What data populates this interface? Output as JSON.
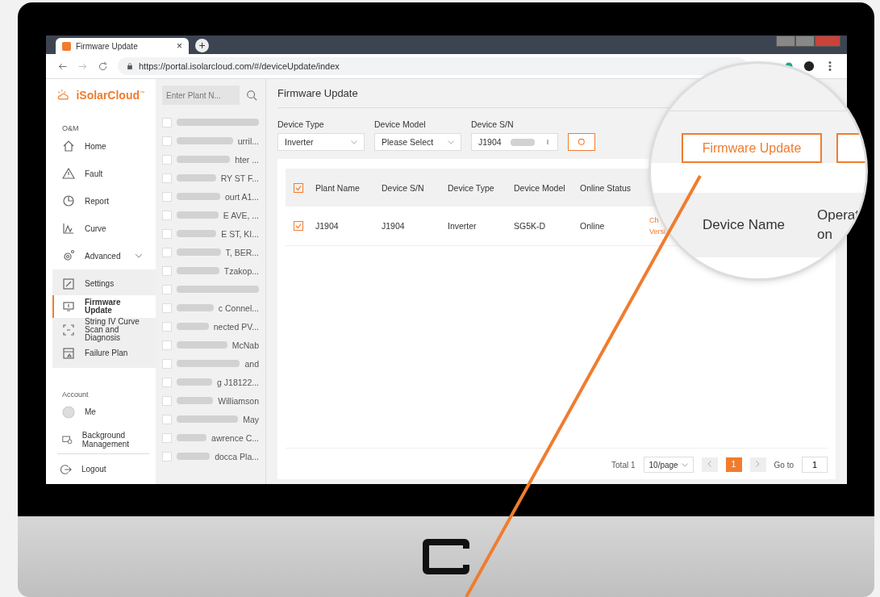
{
  "browser": {
    "tab_title": "Firmware Update",
    "tab_close": "×",
    "new_tab": "+",
    "url": "https://portal.isolarcloud.com/#/deviceUpdate/index"
  },
  "sidebar": {
    "logo": "iSolarCloud$^{™}$",
    "sections": [
      {
        "title": "O&M",
        "items": [
          {
            "kind": "link",
            "label": "Home",
            "selected": false
          },
          {
            "kind": "link",
            "label": "Fault",
            "selected": false
          },
          {
            "kind": "link",
            "label": "Report",
            "selected": false
          },
          {
            "kind": "link",
            "label": "Curve",
            "selected": false
          },
          {
            "kind": "group",
            "label": "Advanced",
            "selected": false,
            "expanded": true,
            "children": [
              {
                "label": "Settings",
                "selected": false
              },
              {
                "label": "Firmware Update",
                "selected": true
              },
              {
                "label": "String IV Curve Scan and Diagnosis",
                "selected": false
              },
              {
                "label": "Failure Plan",
                "selected": false
              }
            ]
          }
        ]
      },
      {
        "title": "Account",
        "items": [
          {
            "kind": "link",
            "label": "Me",
            "selected": false
          },
          {
            "kind": "link",
            "label": "Background Management",
            "selected": false
          }
        ]
      }
    ],
    "logout": "Logout"
  },
  "plant_list": {
    "search_placeholder": "Enter Plant N...",
    "items": [
      {
        "checked": false
      },
      {
        "checked": false,
        "text": "urril..."
      },
      {
        "checked": false,
        "text": "hter ..."
      },
      {
        "checked": false,
        "text": "RY ST F..."
      },
      {
        "checked": false,
        "text": "ourt A1..."
      },
      {
        "checked": false,
        "text": "E AVE, ..."
      },
      {
        "checked": false,
        "text": "E ST, KI..."
      },
      {
        "checked": false,
        "text": "T, BER..."
      },
      {
        "checked": false,
        "text": "Tzakop..."
      },
      {
        "checked": false
      },
      {
        "checked": false,
        "text": "c Connel..."
      },
      {
        "checked": false,
        "text": "nected PV..."
      },
      {
        "checked": false,
        "text": "McNab"
      },
      {
        "checked": false,
        "text": "and"
      },
      {
        "checked": false,
        "text": "g J18122..."
      },
      {
        "checked": false,
        "text": "Williamson"
      },
      {
        "checked": false,
        "text": "May"
      },
      {
        "checked": false,
        "text": "awrence C..."
      },
      {
        "checked": false,
        "text": "docca Pla..."
      }
    ]
  },
  "main": {
    "title": "Firmware Update",
    "filters": [
      {
        "label": "Device Type",
        "value": "Inverter",
        "kind": "select"
      },
      {
        "label": "Device Model",
        "value": "Please Select",
        "kind": "select"
      },
      {
        "label": "Device S/N",
        "value": "J1904",
        "kind": "input"
      }
    ],
    "table": {
      "header_checked": true,
      "columns": [
        "Plant Name",
        "Device S/N",
        "Device Type",
        "Device Model",
        "Online Status"
      ],
      "rows": [
        {
          "checked": true,
          "cells": [
            "J1904",
            "J1904",
            "Inverter",
            "SG5K-D",
            "Online"
          ],
          "action": "Ch Versi"
        }
      ]
    },
    "pagination": {
      "total": "Total 1",
      "page_size": "10/page",
      "pages": [
        {
          "label": "1",
          "selected": true
        }
      ],
      "goto_label": "Go to",
      "goto_value": "1"
    }
  },
  "magnifier": {
    "button": "Firmware Update",
    "columns": [
      "Device Name",
      "Operat on"
    ]
  }
}
